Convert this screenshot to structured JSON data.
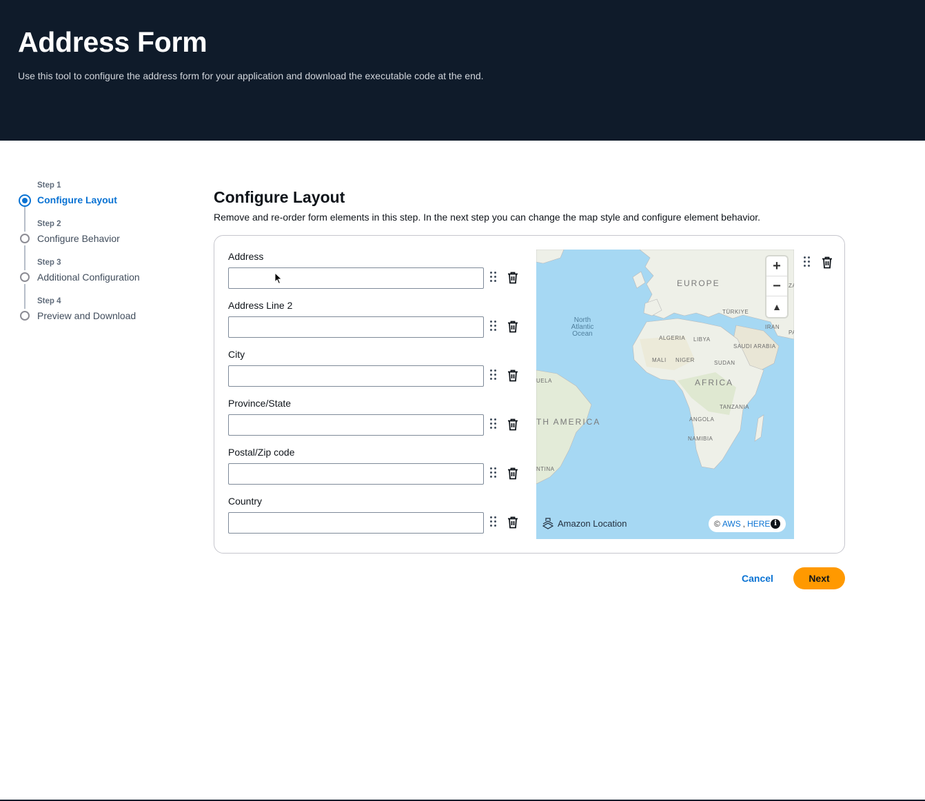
{
  "header": {
    "title": "Address Form",
    "description": "Use this tool to configure the address form for your application and download the executable code at the end."
  },
  "wizard": {
    "steps": [
      {
        "number": "Step 1",
        "label": "Configure Layout",
        "active": true
      },
      {
        "number": "Step 2",
        "label": "Configure Behavior",
        "active": false
      },
      {
        "number": "Step 3",
        "label": "Additional Configuration",
        "active": false
      },
      {
        "number": "Step 4",
        "label": "Preview and Download",
        "active": false
      }
    ]
  },
  "main": {
    "title": "Configure Layout",
    "description": "Remove and re-order form elements in this step. In the next step you can change the map style and configure element behavior."
  },
  "form": {
    "fields": [
      {
        "label": "Address",
        "value": ""
      },
      {
        "label": "Address Line 2",
        "value": ""
      },
      {
        "label": "City",
        "value": ""
      },
      {
        "label": "Province/State",
        "value": ""
      },
      {
        "label": "Postal/Zip code",
        "value": ""
      },
      {
        "label": "Country",
        "value": ""
      }
    ]
  },
  "map": {
    "labels": {
      "europe": "EUROPE",
      "africa": "AFRICA",
      "south_america": "TH AMERICA",
      "ocean": "North Atlantic Ocean",
      "turkiye": "TÜRKIYE",
      "iran": "IRAN",
      "algeria": "ALGERIA",
      "libya": "LIBYA",
      "saudi": "SAUDI ARABIA",
      "mali": "MALI",
      "niger": "NIGER",
      "sudan": "SUDAN",
      "tanzania": "TANZANIA",
      "angola": "ANGOLA",
      "namibia": "NAMIBIA",
      "uela": "UELA",
      "ntina": "NTINA",
      "za": "ZA",
      "pa": "PA"
    },
    "brand": "Amazon Location",
    "attribution_prefix": "©",
    "attribution_aws": "AWS",
    "attribution_sep": ",",
    "attribution_here": "HERE",
    "zoom_in": "+",
    "zoom_out": "−",
    "compass": "▲"
  },
  "footer": {
    "cancel_label": "Cancel",
    "next_label": "Next"
  },
  "colors": {
    "header_bg": "#0f1b2a",
    "accent": "#0972d3",
    "primary_button": "#ff9900",
    "ocean": "#a6d8f3",
    "land": "#eef0e8"
  }
}
